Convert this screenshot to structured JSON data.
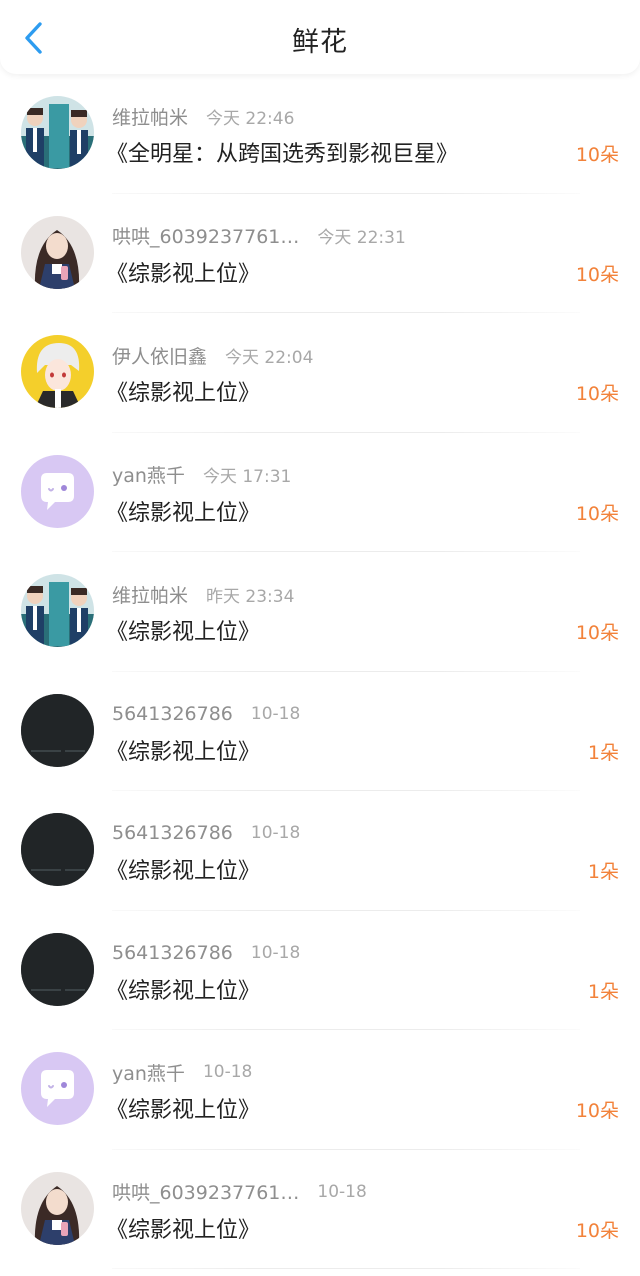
{
  "header": {
    "title": "鲜花",
    "back_icon": "chevron-left-icon",
    "accent_color": "#2d9cf0"
  },
  "colors": {
    "amount": "#f2823a",
    "username": "#8e8e8e",
    "time": "#a8a8a8",
    "book": "#222222"
  },
  "items": [
    {
      "username": "维拉帕米",
      "time": "今天 22:46",
      "book": "《全明星：从跨国选秀到影视巨星》",
      "amount": "10朵",
      "avatar": "avatar-photo-boys"
    },
    {
      "username": "哄哄_6039237761…",
      "time": "今天 22:31",
      "book": "《综影视上位》",
      "amount": "10朵",
      "avatar": "avatar-photo-girl"
    },
    {
      "username": "伊人依旧鑫",
      "time": "今天 22:04",
      "book": "《综影视上位》",
      "amount": "10朵",
      "avatar": "avatar-anime-character"
    },
    {
      "username": "yan燕千",
      "time": "今天 17:31",
      "book": "《综影视上位》",
      "amount": "10朵",
      "avatar": "avatar-default-chat-bubble"
    },
    {
      "username": "维拉帕米",
      "time": "昨天 23:34",
      "book": "《综影视上位》",
      "amount": "10朵",
      "avatar": "avatar-photo-boys"
    },
    {
      "username": "5641326786",
      "time": "10-18",
      "book": "《综影视上位》",
      "amount": "1朵",
      "avatar": "avatar-dark-photo"
    },
    {
      "username": "5641326786",
      "time": "10-18",
      "book": "《综影视上位》",
      "amount": "1朵",
      "avatar": "avatar-dark-photo"
    },
    {
      "username": "5641326786",
      "time": "10-18",
      "book": "《综影视上位》",
      "amount": "1朵",
      "avatar": "avatar-dark-photo"
    },
    {
      "username": "yan燕千",
      "time": "10-18",
      "book": "《综影视上位》",
      "amount": "10朵",
      "avatar": "avatar-default-chat-bubble"
    },
    {
      "username": "哄哄_6039237761…",
      "time": "10-18",
      "book": "《综影视上位》",
      "amount": "10朵",
      "avatar": "avatar-photo-girl"
    }
  ]
}
